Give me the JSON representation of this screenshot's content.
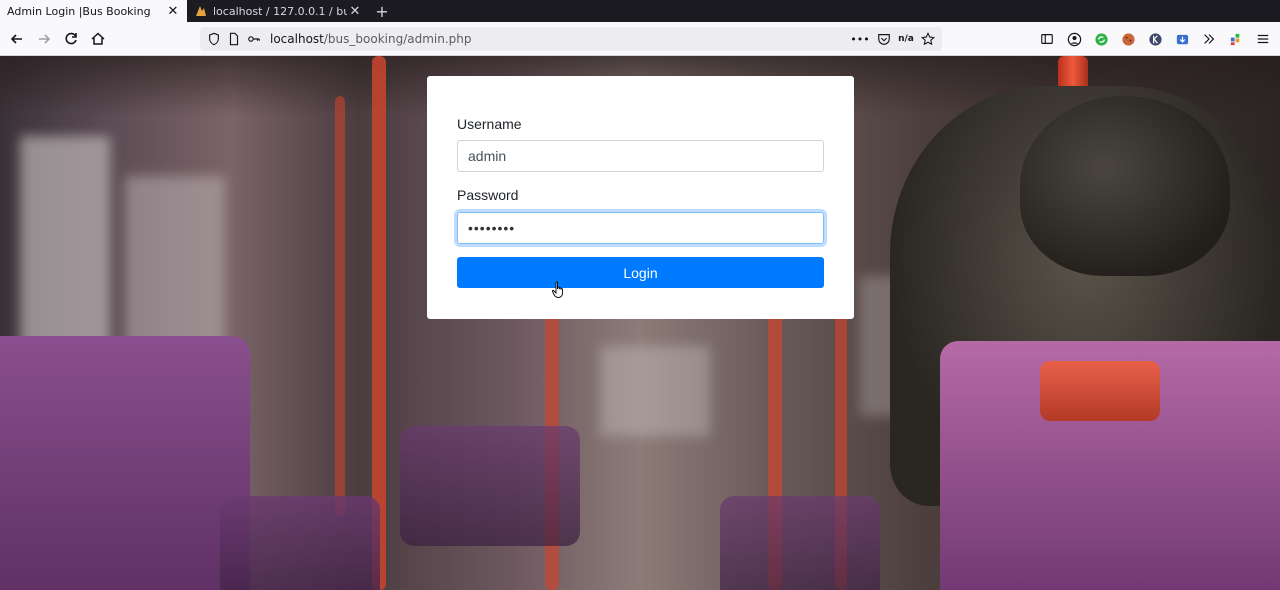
{
  "browser": {
    "tabs": [
      {
        "title": "Admin Login |Bus Booking",
        "active": true
      },
      {
        "title": "localhost / 127.0.0.1 / bus_booki",
        "active": false
      }
    ],
    "new_tab": "+",
    "url_host": "localhost",
    "url_path": "/bus_booking/admin.php",
    "url_more": "•••",
    "reader_badge": "n/a"
  },
  "login": {
    "username_label": "Username",
    "username_value": "admin",
    "password_label": "Password",
    "password_value": "••••••••",
    "submit_label": "Login"
  },
  "colors": {
    "primary": "#007bff",
    "focus_ring": "#80bdff"
  },
  "icons": [
    "back-icon",
    "forward-icon",
    "reload-icon",
    "home-icon",
    "shield-icon",
    "page-icon",
    "key-icon",
    "pocket-icon",
    "star-icon",
    "sidebar-icon",
    "account-icon",
    "extension-icon",
    "overflow-icon",
    "menu-icon"
  ]
}
